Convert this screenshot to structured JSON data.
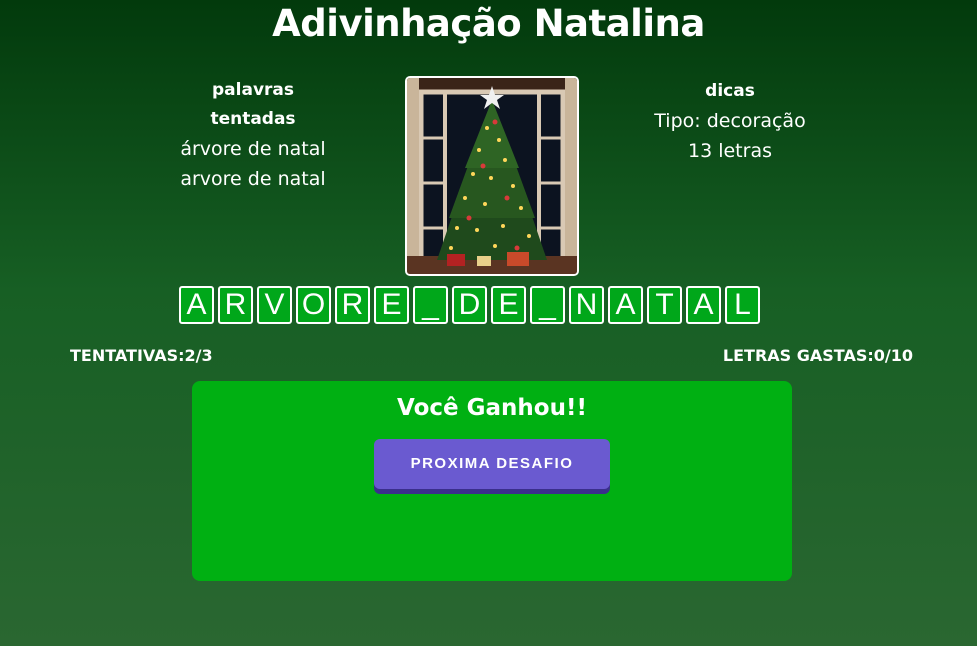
{
  "title": "Adivinhação Natalina",
  "attempted": {
    "heading": "palavras tentadas",
    "items": [
      "árvore de natal",
      "arvore de natal"
    ]
  },
  "hints": {
    "heading": "dicas",
    "type": "Tipo: decoração",
    "length": "13 letras"
  },
  "image": {
    "icon": "christmas-tree-image"
  },
  "word_tiles": [
    "A",
    "R",
    "V",
    "O",
    "R",
    "E",
    "_",
    "D",
    "E",
    "_",
    "N",
    "A",
    "T",
    "A",
    "L"
  ],
  "stats": {
    "attempts": "TENTATIVAS:2/3",
    "letters_used": "LETRAS GASTAS:0/10"
  },
  "result": {
    "message": "Você Ganhou!!",
    "button": "PROXIMA DESAFIO"
  },
  "colors": {
    "tile": "#00a71a",
    "panel": "#00b012",
    "button": "#6a5ad0"
  }
}
